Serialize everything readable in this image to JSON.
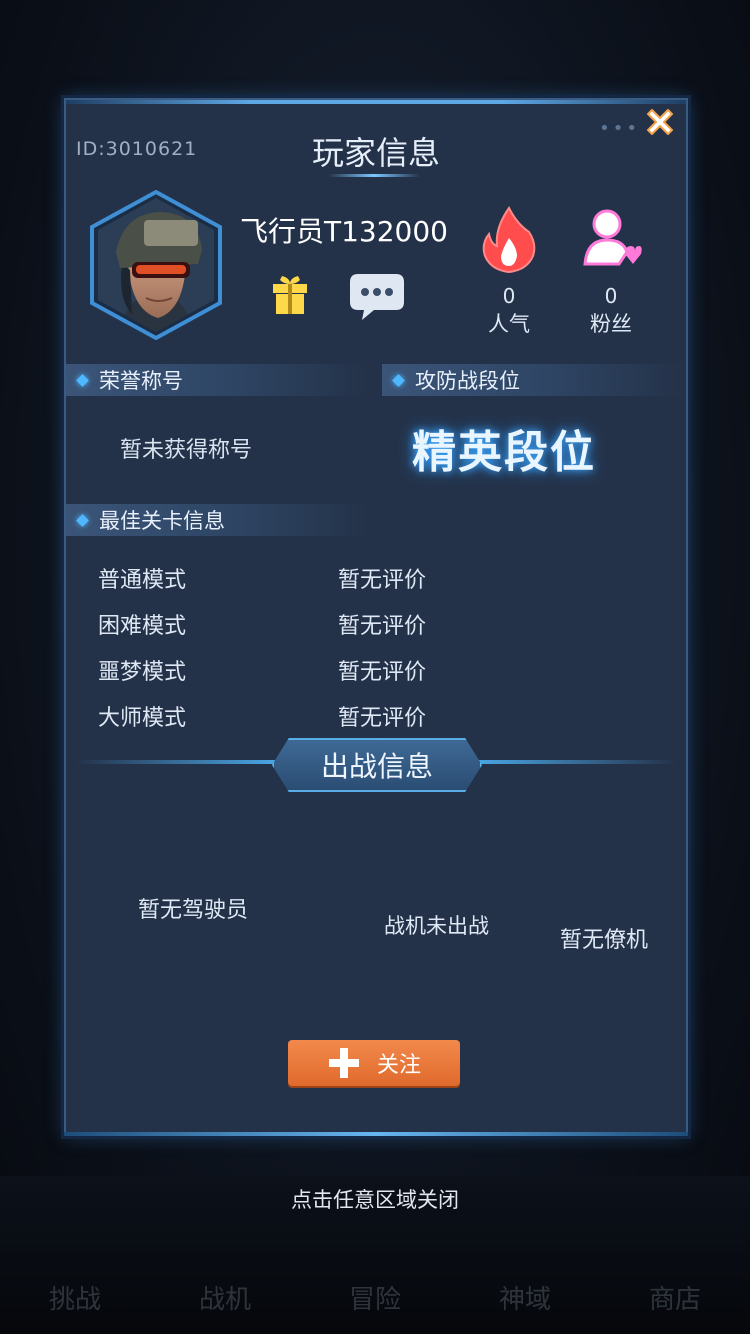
{
  "header": {
    "id_text": "ID:3010621",
    "title": "玩家信息",
    "dots": "•••"
  },
  "profile": {
    "pilot_name": "飞行员T132000",
    "popularity": {
      "value": "0",
      "label": "人气"
    },
    "fans": {
      "value": "0",
      "label": "粉丝"
    }
  },
  "honor": {
    "header": "荣誉称号",
    "text": "暂未获得称号"
  },
  "rank": {
    "header": "攻防战段位",
    "text": "精英段位"
  },
  "best_stage": {
    "header": "最佳关卡信息",
    "rows": [
      {
        "mode": "普通模式",
        "rating": "暂无评价"
      },
      {
        "mode": "困难模式",
        "rating": "暂无评价"
      },
      {
        "mode": "噩梦模式",
        "rating": "暂无评价"
      },
      {
        "mode": "大师模式",
        "rating": "暂无评价"
      }
    ]
  },
  "battle": {
    "title": "出战信息",
    "pilot_empty": "暂无驾驶员",
    "plane_empty": "战机未出战",
    "wingman_empty": "暂无僚机"
  },
  "follow_button": {
    "label": "关注"
  },
  "close_hint": "点击任意区域关闭",
  "colors": {
    "modal_bg": "#243249",
    "accent_blue": "#4fb7ff",
    "follow_orange": "#e97a3a",
    "fire_red": "#ff5a5a",
    "fans_pink": "#ff7ad9",
    "gift_yellow": "#ffd84a"
  },
  "background_nav": [
    "挑战",
    "战机",
    "冒险",
    "神域",
    "商店"
  ]
}
